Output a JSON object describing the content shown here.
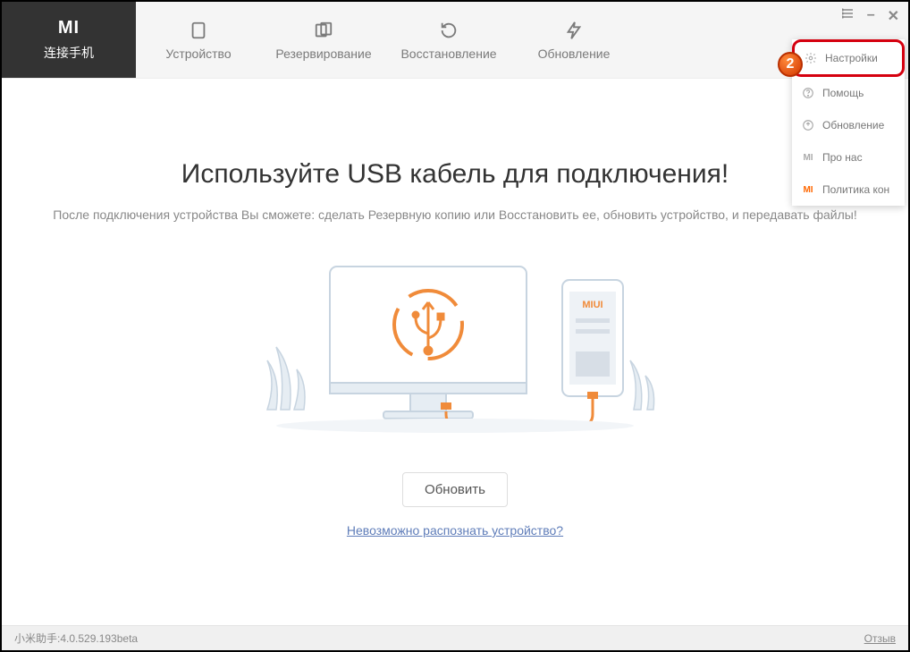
{
  "brand": {
    "logo": "MI",
    "subtitle": "连接手机"
  },
  "nav": {
    "device": "Устройство",
    "backup": "Резервирование",
    "restore": "Восстановление",
    "update": "Обновление"
  },
  "dropdown": {
    "settings": "Настройки",
    "help": "Помощь",
    "update": "Обновление",
    "about": "Про нас",
    "policy": "Политика кон"
  },
  "annotation_badge": "2",
  "main": {
    "heading": "Используйте USB кабель для подключения!",
    "subtitle": "После подключения устройства Вы сможете: сделать Резервную копию или Восстановить ее, обновить устройство, и передавать файлы!",
    "refresh_button": "Обновить",
    "help_link": "Невозможно распознать устройство? "
  },
  "statusbar": {
    "version": "小米助手:4.0.529.193beta",
    "feedback": "Отзыв"
  },
  "phone_label": "MIUI"
}
